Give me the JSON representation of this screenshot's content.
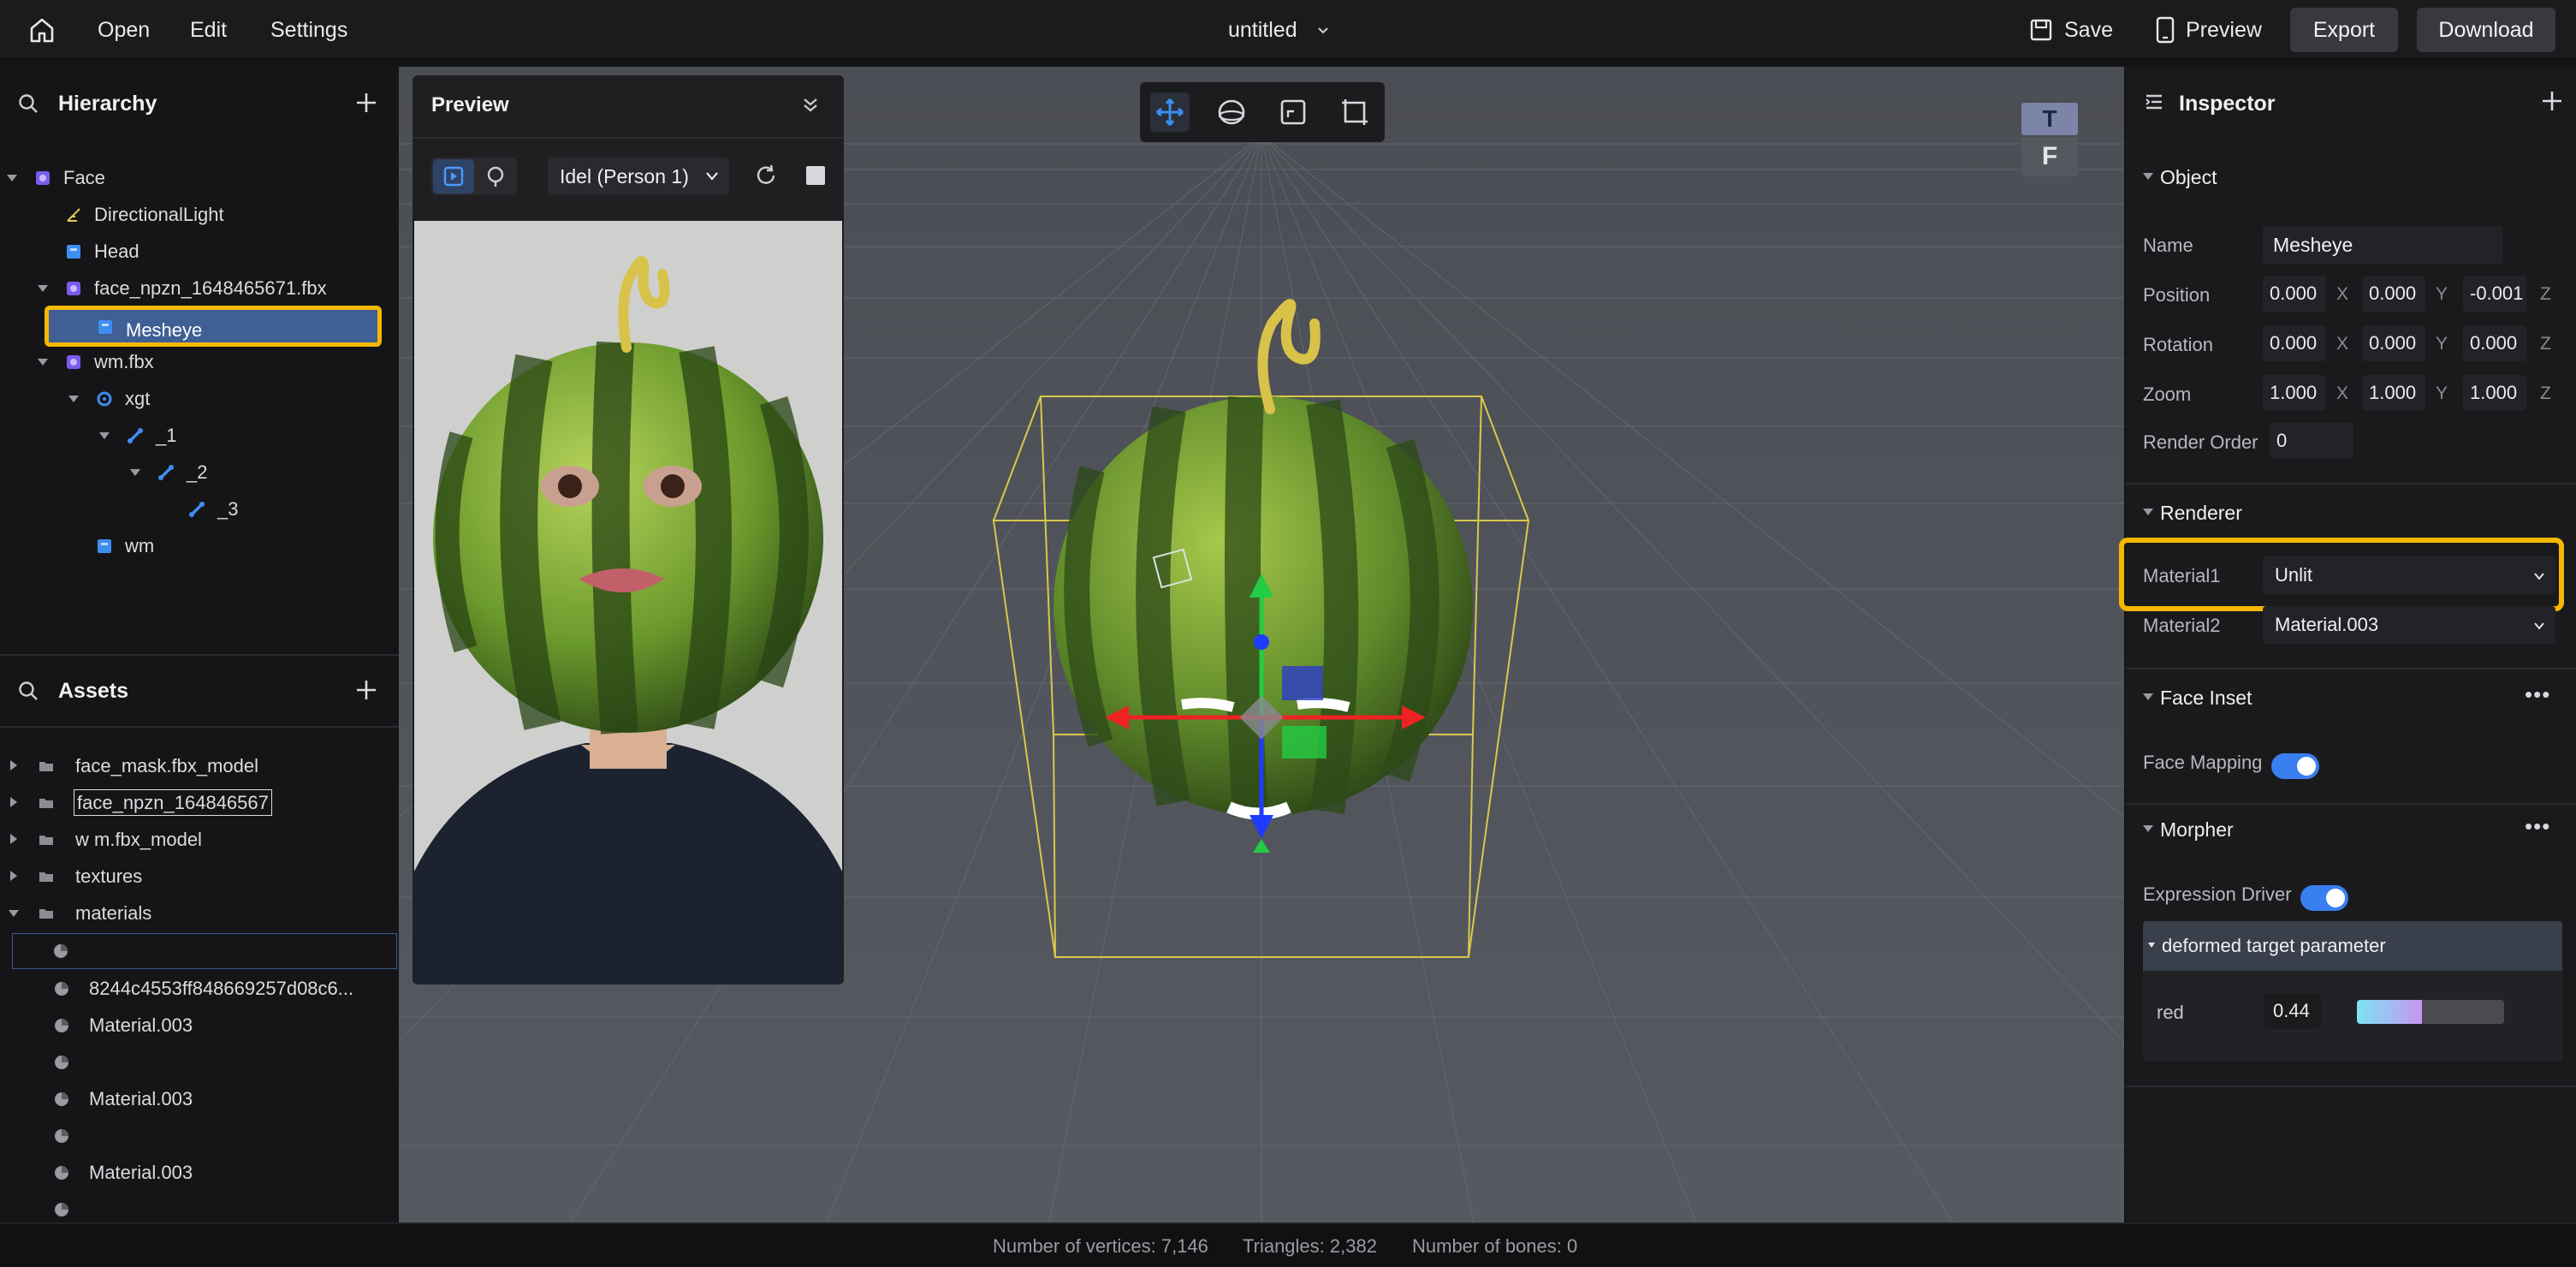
{
  "topbar": {
    "menu": [
      "Open",
      "Edit",
      "Settings"
    ],
    "title": "untitled",
    "save_label": "Save",
    "preview_label": "Preview",
    "export_label": "Export",
    "download_label": "Download"
  },
  "hierarchy": {
    "title": "Hierarchy",
    "items": [
      {
        "label": "Face",
        "icon": "object-icon"
      },
      {
        "label": "DirectionalLight",
        "icon": "light-icon"
      },
      {
        "label": "Head",
        "icon": "mesh-icon"
      },
      {
        "label": "face_npzn_1648465671.fbx",
        "icon": "model-icon"
      },
      {
        "label": "Mesheye",
        "icon": "mesh-icon",
        "selected": true
      },
      {
        "label": "wm.fbx",
        "icon": "model-icon"
      },
      {
        "label": "xgt",
        "icon": "skeleton-icon"
      },
      {
        "label": "_1",
        "icon": "bone-icon"
      },
      {
        "label": "_2",
        "icon": "bone-icon"
      },
      {
        "label": "_3",
        "icon": "bone-icon"
      },
      {
        "label": "wm",
        "icon": "mesh-icon"
      }
    ]
  },
  "assets": {
    "title": "Assets",
    "items": [
      {
        "label": "face_mask.fbx_model",
        "icon": "folder-icon"
      },
      {
        "label": "face_npzn_164846567",
        "icon": "folder-icon",
        "editing": true
      },
      {
        "label": "w m.fbx_model",
        "icon": "folder-icon"
      },
      {
        "label": "textures",
        "icon": "folder-icon"
      },
      {
        "label": "materials",
        "icon": "folder-icon"
      },
      {
        "label": "",
        "icon": "material-icon"
      },
      {
        "label": "8244c4553ff848669257d08c6...",
        "icon": "material-icon"
      },
      {
        "label": "Material.003",
        "icon": "material-icon"
      },
      {
        "label": "",
        "icon": "material-icon"
      },
      {
        "label": "Material.003",
        "icon": "material-icon"
      },
      {
        "label": "",
        "icon": "material-icon"
      },
      {
        "label": "Material.003",
        "icon": "material-icon"
      },
      {
        "label": "",
        "icon": "material-icon"
      }
    ]
  },
  "preview": {
    "title": "Preview",
    "dropdown": "Idel (Person 1)"
  },
  "inspector": {
    "title": "Inspector",
    "object": {
      "title": "Object",
      "name_label": "Name",
      "name_value": "Mesheye",
      "position_label": "Position",
      "position": [
        "0.000",
        "0.000",
        "-0.001"
      ],
      "rotation_label": "Rotation",
      "rotation": [
        "0.000",
        "0.000",
        "0.000"
      ],
      "zoom_label": "Zoom",
      "zoom": [
        "1.000",
        "1.000",
        "1.000"
      ],
      "render_order_label": "Render Order",
      "render_order": "0",
      "axes": [
        "X",
        "Y",
        "Z"
      ]
    },
    "renderer": {
      "title": "Renderer",
      "material1_label": "Material1",
      "material1_value": "Unlit",
      "material2_label": "Material2",
      "material2_value": "Material.003"
    },
    "face_inset": {
      "title": "Face Inset",
      "face_mapping_label": "Face Mapping",
      "face_mapping_on": true
    },
    "morpher": {
      "title": "Morpher",
      "expression_driver_label": "Expression Driver",
      "expression_driver_on": true,
      "param_group": "deformed target parameter",
      "param_name": "red",
      "param_value": "0.44",
      "param_level": 0.44
    }
  },
  "statusbar": {
    "vertices": "Number of vertices: 7,146",
    "triangles": "Triangles: 2,382",
    "bones": "Number of bones: 0"
  },
  "colors": {
    "accent_blue": "#3a7ff0",
    "highlight_yellow": "#f5b800",
    "selection_blue": "#3f5f95"
  }
}
